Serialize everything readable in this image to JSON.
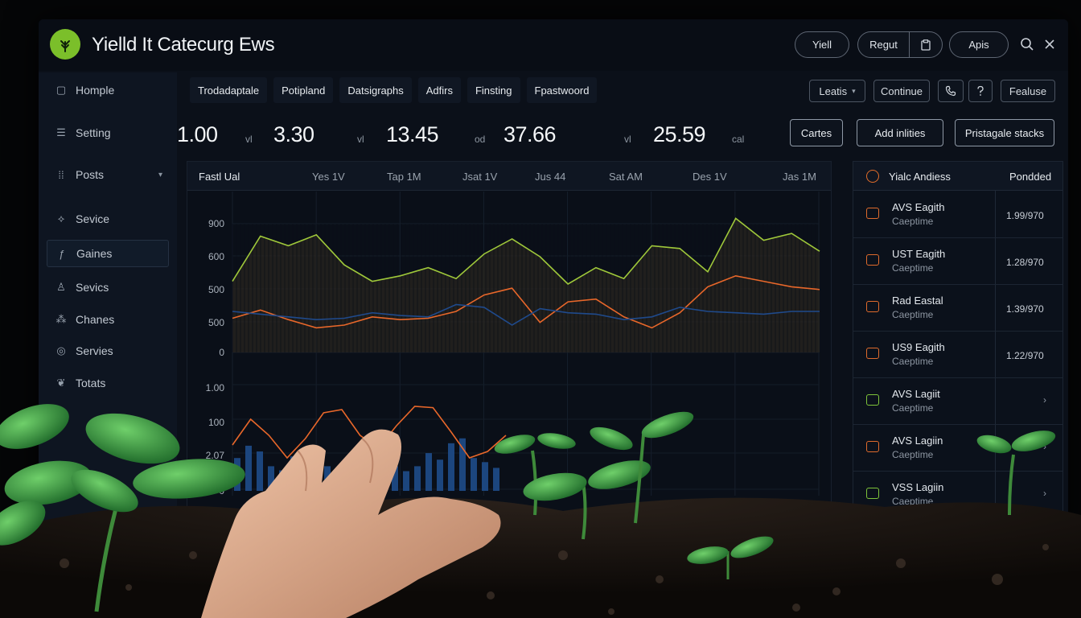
{
  "app": {
    "title": "Yielld It Catecurg Ews",
    "top_buttons": {
      "yield": "Yiell",
      "report": "Regut",
      "apps": "Apis"
    }
  },
  "sidebar": {
    "items": [
      {
        "label": "Homple",
        "icon": "home-icon"
      },
      {
        "label": "Setting",
        "icon": "list-icon"
      },
      {
        "label": "Posts",
        "icon": "grid-icon"
      },
      {
        "label": "Sevice",
        "icon": "leaf-icon"
      },
      {
        "label": "Gaines",
        "icon": "sprout-icon"
      },
      {
        "label": "Sevics",
        "icon": "people-icon"
      },
      {
        "label": "Chanes",
        "icon": "cluster-icon"
      },
      {
        "label": "Servies",
        "icon": "circle-icon"
      },
      {
        "label": "Totats",
        "icon": "plant-icon"
      }
    ]
  },
  "tabs": [
    "Trodadaptale",
    "Potipland",
    "Datsigraphs",
    "Adfirs",
    "Finsting",
    "Fpastwoord"
  ],
  "toolbar": {
    "leads": "Leatis",
    "continue": "Continue",
    "feature": "Fealuse"
  },
  "metrics": [
    {
      "value": "1.00",
      "unit": "vl"
    },
    {
      "value": "3.30",
      "unit": "vl"
    },
    {
      "value": "13.45",
      "unit": "od"
    },
    {
      "value": "37.66",
      "unit": "vl"
    },
    {
      "value": "25.59",
      "unit": "cal"
    }
  ],
  "actions": {
    "cartes": "Cartes",
    "add": "Add inlities",
    "stacks": "Pristagale stacks"
  },
  "chart_data": [
    {
      "type": "line",
      "title": "Fastl Ual",
      "categories": [
        "Yes 1V",
        "Tap 1M",
        "Jsat 1V",
        "Jus 44",
        "Sat AM",
        "Des 1V",
        "Jas 1M"
      ],
      "y_ticks": [
        "900",
        "600",
        "500",
        "500",
        "0"
      ],
      "series": [
        {
          "color": "#9fc83a",
          "values": [
            520,
            850,
            780,
            860,
            640,
            520,
            560,
            620,
            540,
            720,
            830,
            700,
            500,
            620,
            540,
            780,
            760,
            590,
            980,
            820,
            870,
            740
          ]
        },
        {
          "color": "#e8672a",
          "values": [
            250,
            310,
            240,
            180,
            200,
            260,
            240,
            250,
            300,
            420,
            470,
            220,
            370,
            390,
            260,
            180,
            290,
            480,
            560,
            520,
            480,
            460
          ]
        },
        {
          "color": "#1f4a8c",
          "values": [
            300,
            280,
            260,
            240,
            250,
            290,
            270,
            260,
            350,
            330,
            200,
            320,
            290,
            280,
            240,
            260,
            330,
            300,
            290,
            280,
            300,
            300
          ]
        }
      ]
    },
    {
      "type": "bar",
      "y_ticks": [
        "1.00",
        "100",
        "2.07",
        "0"
      ],
      "bars": [
        40,
        55,
        48,
        30,
        25,
        42,
        38,
        50,
        30,
        22,
        28,
        35,
        45,
        52,
        30,
        24,
        30,
        46,
        38,
        58,
        64,
        40,
        35,
        28
      ],
      "line": {
        "color": "#e8672a",
        "values": [
          40,
          80,
          55,
          20,
          50,
          90,
          95,
          55,
          35,
          70,
          100,
          98,
          60,
          20,
          30,
          55
        ]
      }
    }
  ],
  "right_panel": {
    "header": {
      "title": "Yialc Andiess",
      "col2": "Pondded"
    },
    "rows": [
      {
        "name": "AVS Eagith",
        "sub": "Caeptime",
        "value": "1.99/970",
        "icon_color": "orange"
      },
      {
        "name": "UST Eagith",
        "sub": "Caeptime",
        "value": "1.28/970",
        "icon_color": "orange"
      },
      {
        "name": "Rad Eastal",
        "sub": "Caeptime",
        "value": "1.39/970",
        "icon_color": "orange"
      },
      {
        "name": "US9 Eagith",
        "sub": "Caeptime",
        "value": "1.22/970",
        "icon_color": "orange"
      },
      {
        "name": "AVS Lagiit",
        "sub": "Caeptime",
        "value": "",
        "icon_color": "green"
      },
      {
        "name": "AVS Lagiin",
        "sub": "Caeptime",
        "value": "",
        "icon_color": "orange"
      },
      {
        "name": "VSS Lagiin",
        "sub": "Caeptime",
        "value": "",
        "icon_color": "green"
      }
    ]
  }
}
